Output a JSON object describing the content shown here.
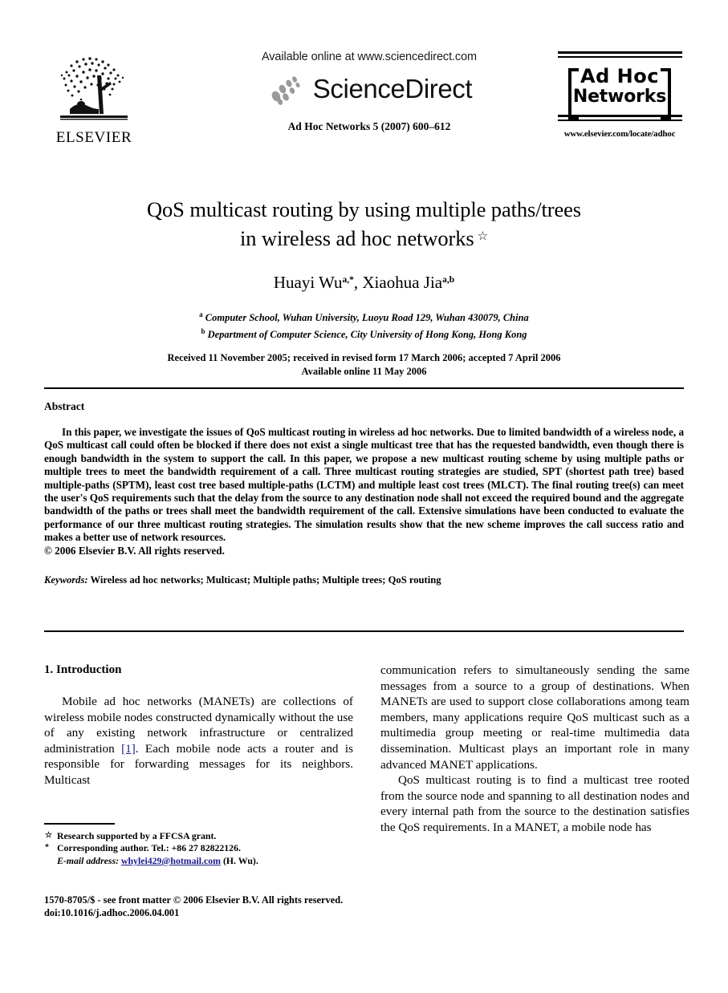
{
  "masthead": {
    "publisher_name": "ELSEVIER",
    "publisher_logo_icon": "elsevier-tree-icon",
    "available_online": "Available online at www.sciencedirect.com",
    "sciencedirect_wordmark": "ScienceDirect",
    "sciencedirect_swoosh_icon": "sciencedirect-swoosh-icon",
    "citation": "Ad Hoc Networks 5 (2007) 600–612",
    "journal_logo_line1": "Ad Hoc",
    "journal_logo_line2": "Networks",
    "journal_url": "www.elsevier.com/locate/adhoc"
  },
  "title_block": {
    "title_line1": "QoS multicast routing by using multiple paths/trees",
    "title_line2": "in wireless ad hoc networks",
    "title_footnote_mark": "☆",
    "authors": [
      {
        "name": "Huayi Wu",
        "marks": "a,*"
      },
      {
        "name": "Xiaohua Jia",
        "marks": "a,b"
      }
    ],
    "authors_separator": ", ",
    "affiliations": [
      {
        "mark": "a",
        "text": "Computer School, Wuhan University, Luoyu Road 129, Wuhan 430079, China"
      },
      {
        "mark": "b",
        "text": "Department of Computer Science, City University of Hong Kong, Hong Kong"
      }
    ],
    "history_line1": "Received 11 November 2005; received in revised form 17 March 2006; accepted 7 April 2006",
    "history_line2": "Available online 11 May 2006"
  },
  "abstract": {
    "heading": "Abstract",
    "body": "In this paper, we investigate the issues of QoS multicast routing in wireless ad hoc networks. Due to limited bandwidth of a wireless node, a QoS multicast call could often be blocked if there does not exist a single multicast tree that has the requested bandwidth, even though there is enough bandwidth in the system to support the call. In this paper, we propose a new multicast routing scheme by using multiple paths or multiple trees to meet the bandwidth requirement of a call. Three multicast routing strategies are studied, SPT (shortest path tree) based multiple-paths (SPTM), least cost tree based multiple-paths (LCTM) and multiple least cost trees (MLCT). The final routing tree(s) can meet the user's QoS requirements such that the delay from the source to any destination node shall not exceed the required bound and the aggregate bandwidth of the paths or trees shall meet the bandwidth requirement of the call. Extensive simulations have been conducted to evaluate the performance of our three multicast routing strategies. The simulation results show that the new scheme improves the call success ratio and makes a better use of network resources.",
    "copyright": "© 2006 Elsevier B.V. All rights reserved.",
    "keywords_label": "Keywords:",
    "keywords_text": "Wireless ad hoc networks; Multicast; Multiple paths; Multiple trees; QoS routing"
  },
  "body": {
    "section_heading": "1. Introduction",
    "left_para_1_before_cite": "Mobile ad hoc networks (MANETs) are collections of wireless mobile nodes constructed dynamically without the use of any existing network infrastructure or centralized administration ",
    "left_para_1_cite": "[1]",
    "left_para_1_after_cite": ". Each mobile node acts a router and is responsible for forwarding messages for its neighbors. Multicast",
    "right_para_1": "communication refers to simultaneously sending the same messages from a source to a group of destinations. When MANETs are used to support close collaborations among team members, many applications require QoS multicast such as a multimedia group meeting or real-time multimedia data dissemination. Multicast plays an important role in many advanced MANET applications.",
    "right_para_2": "QoS multicast routing is to find a multicast tree rooted from the source node and spanning to all destination nodes and every internal path from the source to the destination satisfies the QoS requirements. In a MANET, a mobile node has"
  },
  "footnotes": [
    {
      "mark": "☆",
      "text": "Research supported by a FFCSA grant."
    },
    {
      "mark": "*",
      "text": "Corresponding author. Tel.: +86 27 82822126."
    }
  ],
  "email_footnote": {
    "label": "E-mail address:",
    "address": "whylei429@hotmail.com",
    "attribution": "(H. Wu)."
  },
  "imprint": {
    "line1": "1570-8705/$ - see front matter © 2006 Elsevier B.V. All rights reserved.",
    "line2": "doi:10.1016/j.adhoc.2006.04.001"
  },
  "colors": {
    "text": "#000000",
    "link": "#1a1a8c",
    "page_background": "#ffffff"
  }
}
